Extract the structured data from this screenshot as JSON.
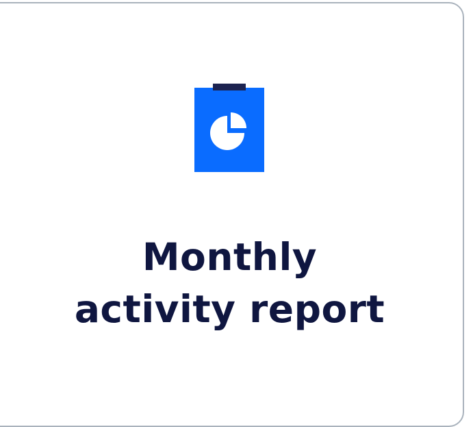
{
  "card": {
    "title_line_1": "Monthly",
    "title_line_2": "activity report",
    "icon": "report-pie-chart-icon"
  },
  "colors": {
    "accent": "#0a6cff",
    "clip": "#1c2350",
    "title_text": "#0f1640",
    "card_border": "#a9b2bc",
    "background": "#ffffff"
  }
}
